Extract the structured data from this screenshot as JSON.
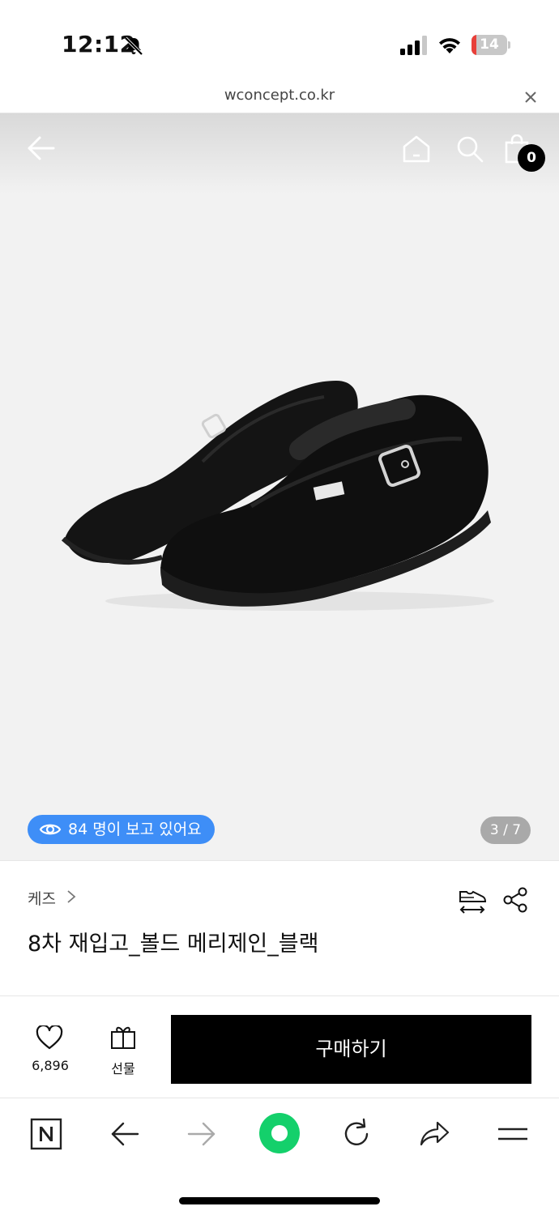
{
  "status_bar": {
    "time": "12:12",
    "battery_level": "14",
    "battery_fraction": 0.14,
    "colors": {
      "battery_low": "#e8403a"
    }
  },
  "url_bar": {
    "url": "wconcept.co.kr"
  },
  "header": {
    "cart_count": "0",
    "icons": [
      "arrow-left-icon",
      "home-icon",
      "search-icon",
      "shopping-bag-icon"
    ]
  },
  "gallery": {
    "viewers_text": "84 명이 보고 있어요",
    "page_indicator": "3 / 7",
    "colors": {
      "viewers_pill": "#3e8ef7"
    }
  },
  "product": {
    "brand": "케즈",
    "title": "8차 재입고_볼드 메리제인_블랙"
  },
  "purchase": {
    "wish_count": "6,896",
    "gift_label": "선물",
    "buy_label": "구매하기"
  },
  "browser_toolbar": {
    "icons": [
      "naver-n-icon",
      "back-arrow-icon",
      "forward-arrow-icon",
      "green-dot-icon",
      "reload-icon",
      "share-arrow-icon",
      "menu-icon"
    ],
    "colors": {
      "green": "#14d06b"
    }
  }
}
